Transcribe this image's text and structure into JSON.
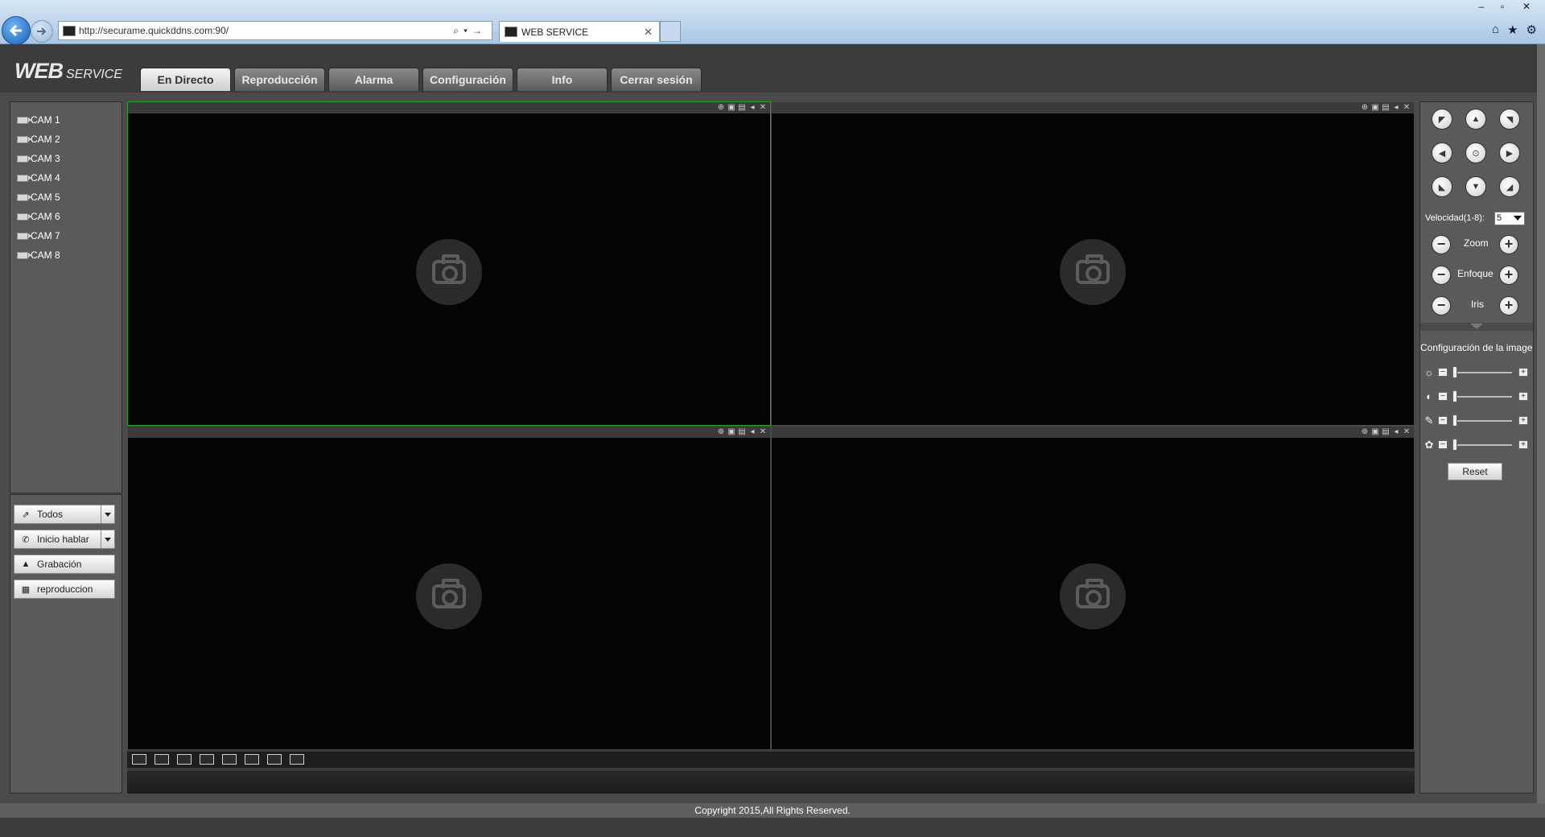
{
  "browser": {
    "url": "http://securame.quickddns.com:90/",
    "tab_title": "WEB SERVICE",
    "window_controls": {
      "minimize": "–",
      "restore": "▫",
      "close": "✕"
    },
    "toolbar_icons": [
      "home-icon",
      "star-icon",
      "gear-icon"
    ]
  },
  "app": {
    "logo_main": "WEB",
    "logo_sub": "SERVICE",
    "tabs": [
      {
        "label": "En Directo",
        "active": true
      },
      {
        "label": "Reproducción",
        "active": false
      },
      {
        "label": "Alarma",
        "active": false
      },
      {
        "label": "Configuración",
        "active": false
      },
      {
        "label": "Info",
        "active": false
      },
      {
        "label": "Cerrar sesión",
        "active": false
      }
    ]
  },
  "cameras": [
    "CAM 1",
    "CAM 2",
    "CAM 3",
    "CAM 4",
    "CAM 5",
    "CAM 6",
    "CAM 7",
    "CAM 8"
  ],
  "actions": {
    "all": "Todos",
    "talk": "Inicio hablar",
    "record": "Grabación",
    "playback": "reproduccion"
  },
  "video": {
    "cells": 4,
    "selected_cell": 1,
    "layout_buttons": [
      "layout-1-icon",
      "layout-2-icon",
      "layout-3-icon",
      "layout-4-icon",
      "single-view-icon",
      "quad-view-icon",
      "nine-view-icon",
      "fullscreen-icon"
    ]
  },
  "ptz": {
    "speed_label": "Velocidad(1-8):",
    "speed_value": "5",
    "zoom_label": "Zoom",
    "focus_label": "Enfoque",
    "iris_label": "Iris",
    "image_settings_title": "Configuración de la image",
    "sliders": [
      {
        "name": "brightness",
        "level": 0.0
      },
      {
        "name": "contrast",
        "level": 0.0
      },
      {
        "name": "saturation",
        "level": 0.0
      },
      {
        "name": "hue",
        "level": 0.0
      }
    ],
    "reset_label": "Reset"
  },
  "footer": {
    "copyright": "Copyright 2015,All Rights Reserved."
  },
  "colors": {
    "selected_border": "#21a321",
    "panel_bg": "#5a5a5a",
    "active_tab_bg": "#e0e0e0"
  }
}
